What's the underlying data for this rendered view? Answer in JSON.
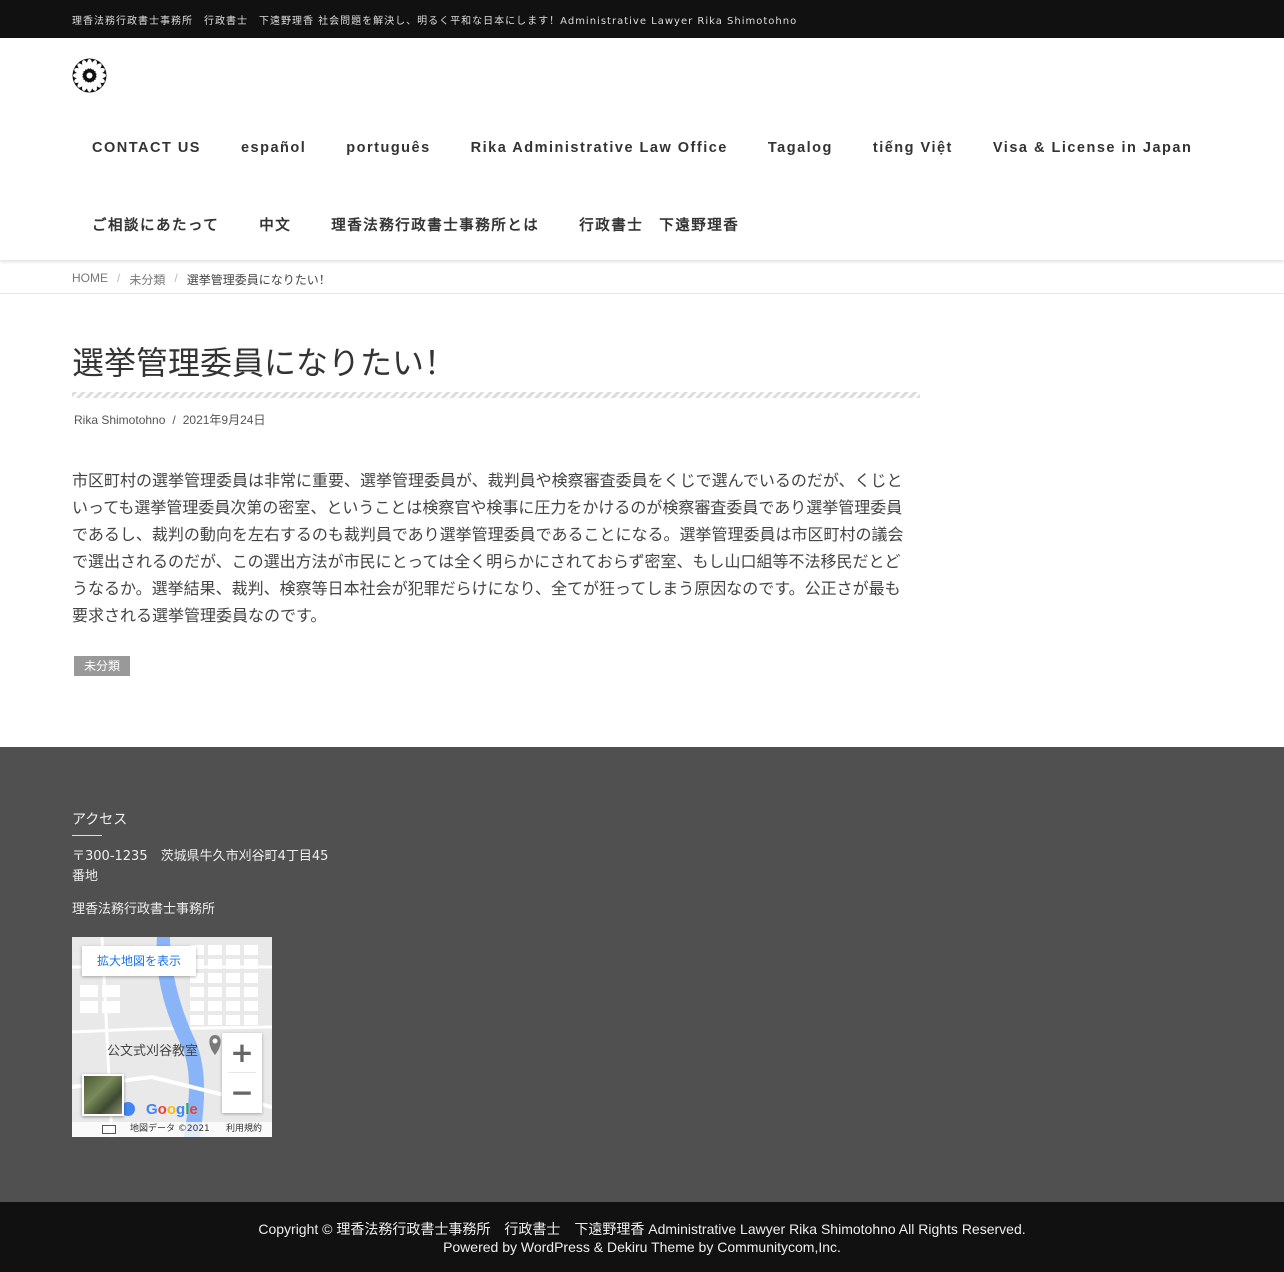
{
  "topbar": {
    "tagline": "理香法務行政書士事務所　行政書士　下遠野理香 社会問題を解決し、明るく平和な日本にします！Administrative Lawyer Rika Shimotohno"
  },
  "header": {
    "logo_icon": "chrysanthemum-crest-icon",
    "nav_row1": [
      "CONTACT US",
      "español",
      "português",
      "Rika Administrative Law Office",
      "Tagalog",
      "tiếng Việt",
      "Visa & License in Japan"
    ],
    "nav_row2": [
      "ご相談にあたって",
      "中文",
      "理香法務行政書士事務所とは",
      "行政書士　下遠野理香"
    ]
  },
  "breadcrumb": {
    "home": "HOME",
    "category": "未分類",
    "current": "選挙管理委員になりたい！"
  },
  "post": {
    "title": "選挙管理委員になりたい！",
    "author": "Rika Shimotohno",
    "separator": "/",
    "date": "2021年9月24日",
    "body": "市区町村の選挙管理委員は非常に重要、選挙管理委員が、裁判員や検察審査委員をくじで選んでいるのだが、くじといっても選挙管理委員次第の密室、ということは検察官や検事に圧力をかけるのが検察審査委員であり選挙管理委員であるし、裁判の動向を左右するのも裁判員であり選挙管理委員であることになる。選挙管理委員は市区町村の議会で選出されるのだが、この選出方法が市民にとっては全く明らかにされておらず密室、もし山口組等不法移民だとどうなるか。選挙結果、裁判、検察等日本社会が犯罪だらけになり、全てが狂ってしまう原因なのです。公正さが最も要求される選挙管理委員なのです。",
    "tag": "未分類"
  },
  "footer": {
    "title": "アクセス",
    "address": "〒300-1235　茨城県牛久市刈谷町4丁目45番地",
    "office": "理香法務行政書士事務所",
    "map": {
      "expand_label": "拡大地図を表示",
      "place_label": "公文式刈谷教室",
      "zoom_in": "+",
      "zoom_out": "−",
      "google": [
        "G",
        "o",
        "o",
        "g",
        "l",
        "e"
      ],
      "google_colors": [
        "#4285f4",
        "#ea4335",
        "#fbbc05",
        "#4285f4",
        "#34a853",
        "#ea4335"
      ],
      "data_text": "地図データ ©2021",
      "terms": "利用規約"
    }
  },
  "bottombar": {
    "copyright": "Copyright © 理香法務行政書士事務所　行政書士　下遠野理香 Administrative Lawyer Rika Shimotohno All Rights Reserved.",
    "powered": "Powered by WordPress & Dekiru Theme by Communitycom,Inc."
  }
}
